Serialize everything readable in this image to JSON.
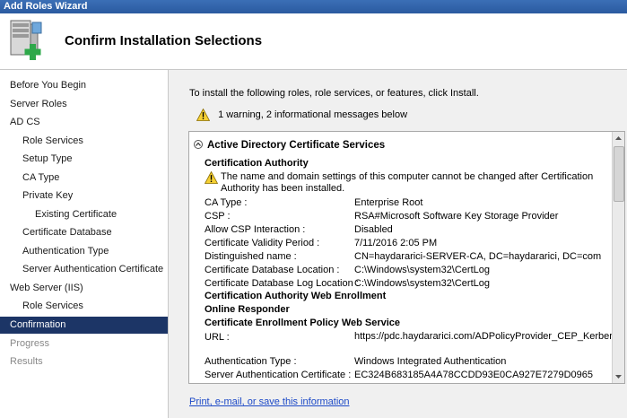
{
  "window": {
    "title": "Add Roles Wizard"
  },
  "header": {
    "heading": "Confirm Installation Selections",
    "icon": "server-add-roles-icon"
  },
  "sidebar": {
    "items": [
      {
        "label": "Before You Begin",
        "level": 0,
        "state": "normal"
      },
      {
        "label": "Server Roles",
        "level": 0,
        "state": "normal"
      },
      {
        "label": "AD CS",
        "level": 0,
        "state": "normal"
      },
      {
        "label": "Role Services",
        "level": 1,
        "state": "normal"
      },
      {
        "label": "Setup Type",
        "level": 1,
        "state": "normal"
      },
      {
        "label": "CA Type",
        "level": 1,
        "state": "normal"
      },
      {
        "label": "Private Key",
        "level": 1,
        "state": "normal"
      },
      {
        "label": "Existing Certificate",
        "level": 2,
        "state": "normal"
      },
      {
        "label": "Certificate Database",
        "level": 1,
        "state": "normal"
      },
      {
        "label": "Authentication Type",
        "level": 1,
        "state": "normal"
      },
      {
        "label": "Server Authentication Certificate",
        "level": 1,
        "state": "normal"
      },
      {
        "label": "Web Server (IIS)",
        "level": 0,
        "state": "normal"
      },
      {
        "label": "Role Services",
        "level": 1,
        "state": "normal"
      },
      {
        "label": "Confirmation",
        "level": 0,
        "state": "active"
      },
      {
        "label": "Progress",
        "level": 0,
        "state": "disabled"
      },
      {
        "label": "Results",
        "level": 0,
        "state": "disabled"
      }
    ]
  },
  "main": {
    "intro": "To install the following roles, role services, or features, click Install.",
    "summary": "1 warning, 2 informational messages below",
    "section_title": "Active Directory Certificate Services",
    "ca_heading": "Certification Authority",
    "warning_text": "The name and domain settings of this computer cannot be changed after Certification Authority has been installed.",
    "ca_rows": [
      {
        "key": "CA Type :",
        "value": "Enterprise Root"
      },
      {
        "key": "CSP :",
        "value": "RSA#Microsoft Software Key Storage Provider"
      },
      {
        "key": "Allow CSP Interaction :",
        "value": "Disabled"
      },
      {
        "key": "Certificate Validity Period :",
        "value": "7/11/2016 2:05 PM"
      },
      {
        "key": "Distinguished name :",
        "value": "CN=haydararici-SERVER-CA, DC=haydararici, DC=com"
      },
      {
        "key": "Certificate Database Location :",
        "value": "C:\\Windows\\system32\\CertLog"
      },
      {
        "key": "Certificate Database Log Location :",
        "value": "C:\\Windows\\system32\\CertLog"
      }
    ],
    "web_enrollment_heading": "Certification Authority Web Enrollment",
    "online_responder_heading": "Online Responder",
    "cep_heading": "Certificate Enrollment Policy Web Service",
    "cep_rows": [
      {
        "key": "URL :",
        "value": "https://pdc.haydararici.com/ADPolicyProvider_CEP_Kerberos/service.svc/CEP"
      },
      {
        "key": "Authentication Type :",
        "value": "Windows Integrated Authentication"
      },
      {
        "key": "Server Authentication Certificate :",
        "value": "EC324B683185A4A78CCDD93E0CA927E7279D0965"
      }
    ],
    "link": "Print, e-mail, or save this information"
  }
}
